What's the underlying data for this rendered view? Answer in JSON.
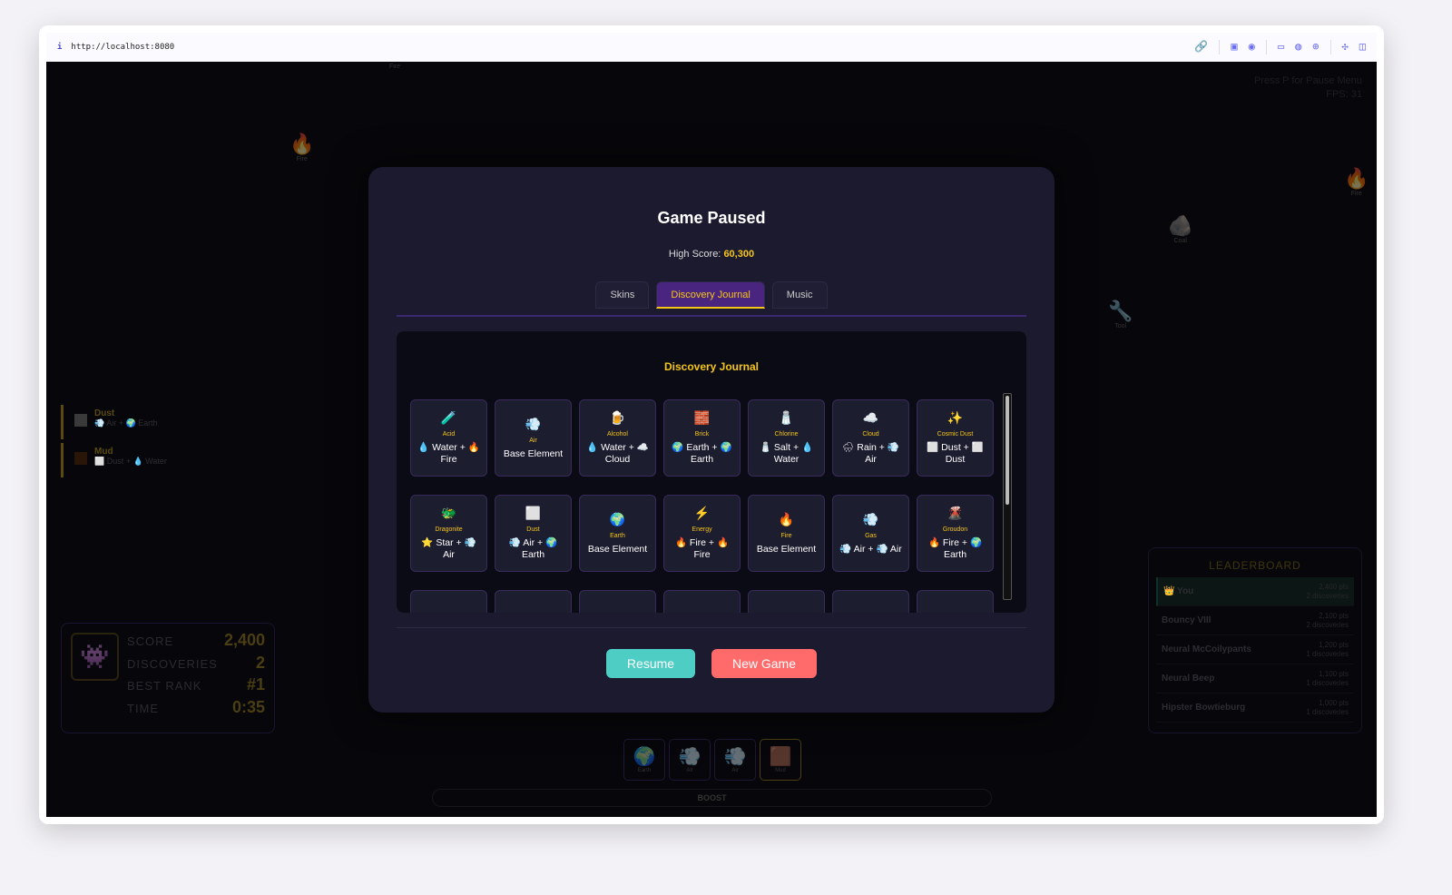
{
  "browser": {
    "url": "http://localhost:8080",
    "tool_icons": [
      "link-icon",
      "media-icon",
      "camera-icon",
      "terminal-icon",
      "globe-icon",
      "crosshair-icon",
      "extension-icon",
      "sidebar-icon"
    ]
  },
  "hud": {
    "hint": "Press P for Pause Menu",
    "fps": "FPS: 31"
  },
  "floating": [
    {
      "icon": "🔥",
      "label": "Fire"
    },
    {
      "icon": "🔥",
      "label": "Fire"
    },
    {
      "icon": "🪨",
      "label": "Coal"
    },
    {
      "icon": "🔧",
      "label": "Tool"
    },
    {
      "icon": "",
      "label": "Fire"
    }
  ],
  "recent": [
    {
      "name": "Dust",
      "recipe": "💨 Air + 🌍 Earth",
      "color": "#6a6a6a"
    },
    {
      "name": "Mud",
      "recipe": "⬜ Dust + 💧 Water",
      "color": "#4a2a14"
    }
  ],
  "stats": {
    "icon": "👾",
    "score_label": "SCORE",
    "score": "2,400",
    "disc_label": "DISCOVERIES",
    "disc": "2",
    "rank_label": "BEST RANK",
    "rank": "#1",
    "time_label": "TIME",
    "time": "0:35"
  },
  "leaderboard": {
    "title": "LEADERBOARD",
    "rows": [
      {
        "name": "👑 You",
        "pts": "2,400 pts",
        "disc": "2 discoveries"
      },
      {
        "name": "Bouncy VIII",
        "pts": "2,100 pts",
        "disc": "2 discoveries"
      },
      {
        "name": "Neural McCoilypants",
        "pts": "1,200 pts",
        "disc": "1 discoveries"
      },
      {
        "name": "Neural Beep",
        "pts": "1,100 pts",
        "disc": "1 discoveries"
      },
      {
        "name": "Hipster Bowtieburg",
        "pts": "1,000 pts",
        "disc": "1 discoveries"
      }
    ]
  },
  "slots": [
    {
      "icon": "🌍",
      "label": "Earth"
    },
    {
      "icon": "💨",
      "label": "Air"
    },
    {
      "icon": "💨",
      "label": "Air"
    },
    {
      "icon": "🟫",
      "label": "Mud"
    }
  ],
  "boost": "BOOST",
  "modal": {
    "title": "Game Paused",
    "high_score_label": "High Score:",
    "high_score": "60,300",
    "tabs": [
      "Skins",
      "Discovery Journal",
      "Music"
    ],
    "active_tab": "Discovery Journal",
    "journal_title": "Discovery Journal",
    "entries": [
      {
        "icon": "🧪",
        "name": "Acid",
        "recipe": "💧 Water + 🔥 Fire"
      },
      {
        "icon": "💨",
        "name": "Air",
        "recipe": "Base Element"
      },
      {
        "icon": "🍺",
        "name": "Alcohol",
        "recipe": "💧 Water + ☁️ Cloud"
      },
      {
        "icon": "🧱",
        "name": "Brick",
        "recipe": "🌍 Earth + 🌍 Earth"
      },
      {
        "icon": "🧂",
        "name": "Chlorine",
        "recipe": "🧂 Salt + 💧 Water"
      },
      {
        "icon": "☁️",
        "name": "Cloud",
        "recipe": "🌧 Rain + 💨 Air"
      },
      {
        "icon": "✨",
        "name": "Cosmic Dust",
        "recipe": "⬜ Dust + ⬜ Dust"
      },
      {
        "icon": "🐲",
        "name": "Dragonite",
        "recipe": "⭐ Star + 💨 Air"
      },
      {
        "icon": "⬜",
        "name": "Dust",
        "recipe": "💨 Air + 🌍 Earth"
      },
      {
        "icon": "🌍",
        "name": "Earth",
        "recipe": "Base Element"
      },
      {
        "icon": "⚡",
        "name": "Energy",
        "recipe": "🔥 Fire + 🔥 Fire"
      },
      {
        "icon": "🔥",
        "name": "Fire",
        "recipe": "Base Element"
      },
      {
        "icon": "💨",
        "name": "Gas",
        "recipe": "💨 Air + 💨 Air"
      },
      {
        "icon": "🌋",
        "name": "Groudon",
        "recipe": "🔥 Fire + 🌍 Earth"
      }
    ],
    "resume": "Resume",
    "new_game": "New Game"
  },
  "colors": {
    "accent": "#f5c518",
    "resume": "#4ecdc4",
    "new_game": "#ff6b6b",
    "tab_active": "#4a2580"
  }
}
